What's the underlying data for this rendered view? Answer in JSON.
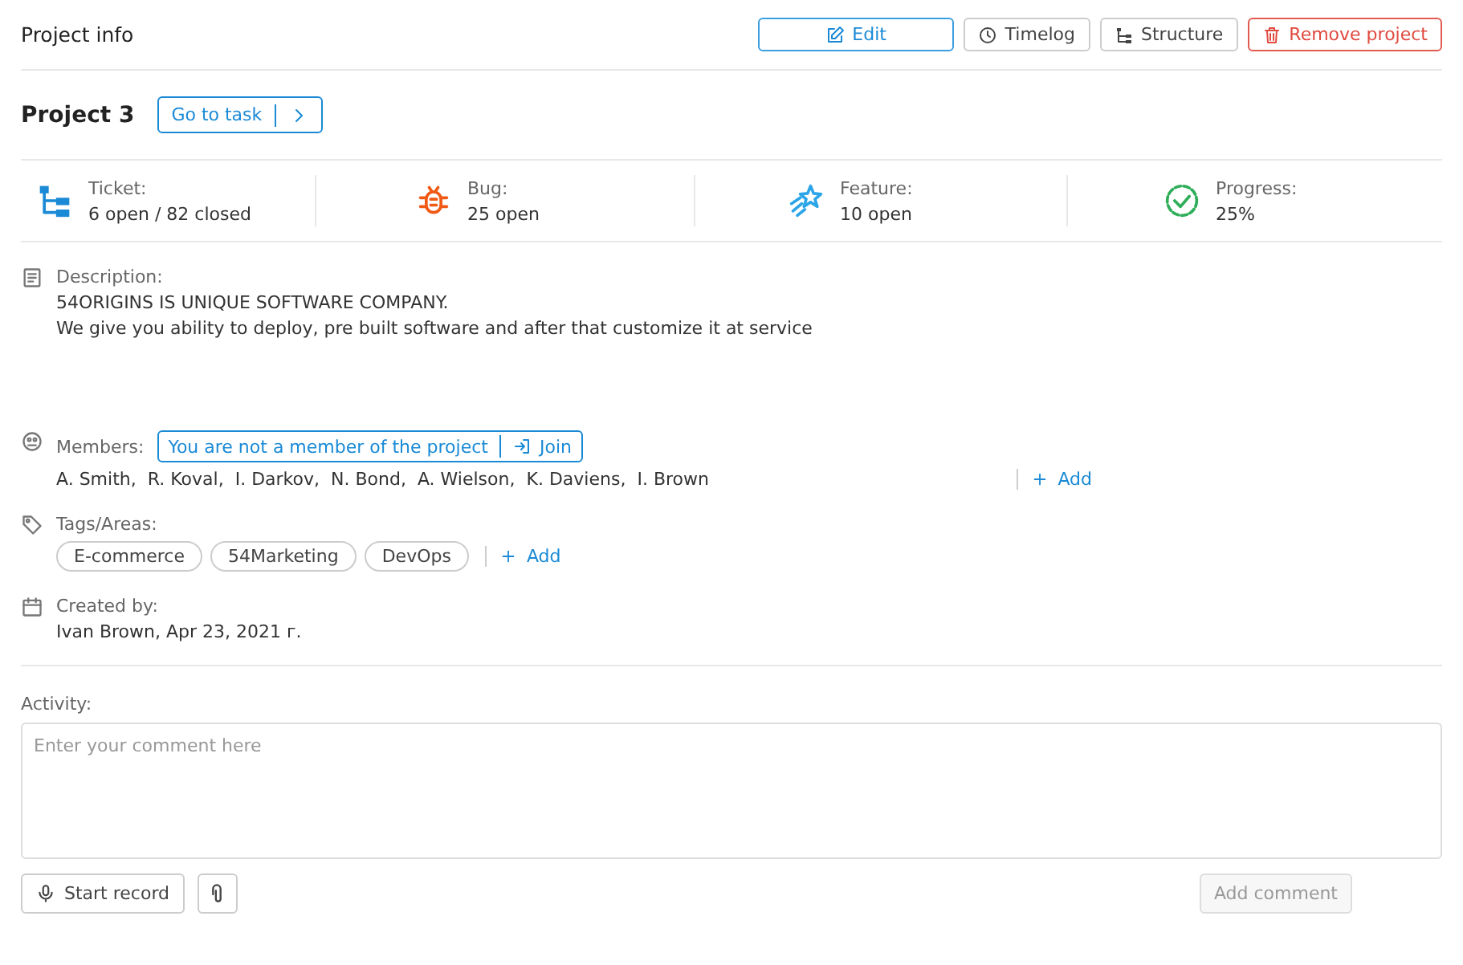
{
  "header": {
    "title": "Project info",
    "actions": [
      {
        "label": "Edit",
        "kind": "edit"
      },
      {
        "label": "Timelog",
        "kind": "timelog"
      },
      {
        "label": "Structure",
        "kind": "structure"
      },
      {
        "label": "Remove project",
        "kind": "remove"
      }
    ]
  },
  "project": {
    "name": "Project 3",
    "goto": "Go to task"
  },
  "stats": [
    {
      "kind": "ticket",
      "label": "Ticket:",
      "value": "6 open / 82 closed"
    },
    {
      "kind": "bug",
      "label": "Bug:",
      "value": "25 open"
    },
    {
      "kind": "feature",
      "label": "Feature:",
      "value": "10 open"
    },
    {
      "kind": "progress",
      "label": "Progress:",
      "value": "25%"
    }
  ],
  "description": {
    "label": "Description:",
    "lines": [
      "54ORIGINS IS UNIQUE SOFTWARE COMPANY.",
      "We give you ability to deploy, pre built software and after that customize it at service"
    ]
  },
  "members": {
    "label": "Members:",
    "notice": "You are not a member of the project",
    "join": "Join",
    "names": [
      "A. Smith,",
      "R. Koval,",
      "I. Darkov,",
      "N. Bond,",
      "A. Wielson,",
      "K. Daviens,",
      "I. Brown"
    ],
    "add": "Add"
  },
  "tags": {
    "label": "Tags/Areas:",
    "items": [
      "E-commerce",
      "54Marketing",
      "DevOps"
    ],
    "add": "Add"
  },
  "created": {
    "label": "Created by:",
    "value": "Ivan Brown, Apr 23, 2021 г."
  },
  "activity": {
    "label": "Activity:",
    "placeholder": "Enter your comment here",
    "record": "Start record",
    "submit": {
      "label": "Add comment",
      "disabled": true
    }
  }
}
